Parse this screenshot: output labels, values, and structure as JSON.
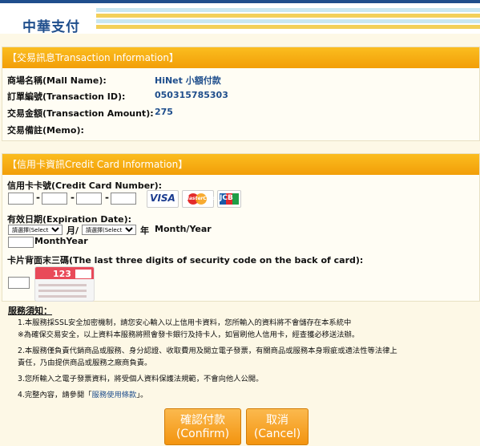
{
  "header": {
    "logo": "中華支付"
  },
  "transaction": {
    "title": "【交易訊息Transaction Information】",
    "mall_label": "商場名稱(Mall Name):",
    "mall_value": "HiNet 小額付款",
    "order_label": "訂單編號(Transaction ID):",
    "order_value": "050315785303",
    "amount_label": "交易金額(Transaction Amount):",
    "amount_value": "275",
    "memo_label": "交易備註(Memo):"
  },
  "card": {
    "title": "【信用卡資訊Credit Card Information】",
    "number_label": "信用卡卡號(Credit Card Number):",
    "logos": {
      "visa": "VISA",
      "master": "MasterCard",
      "jcb": "JCB"
    },
    "expiry_label": "有效日期(Expiration Date):",
    "month_select": "請選擇(Select)",
    "month_text": "月/",
    "year_select": "請選擇(Select)",
    "year_text": "年",
    "month_year_text": "Month/Year",
    "month_year_text2": "MonthYear",
    "cvv_label": "卡片背面末三碼(The last three digits of security code on the back of card):",
    "cvv_example": "123"
  },
  "service": {
    "title": "服務須知：",
    "items": [
      "1.本服務採SSL安全加密機制，請您安心輸入以上信用卡資料，您所輸入的資料將不會儲存在本系統中",
      "※為確保交易安全，以上資料本服務將照會發卡銀行及持卡人，如冒刷他人信用卡，經查獲必移送法辦。",
      "2.本服務僅負責代銷商品或服務、身分認證、收取費用及開立電子發票，有關商品或服務本身瑕疵或適法性等法律上",
      "責任，乃由提供商品或服務之廠商負責。",
      "3.您所輸入之電子發票資料，將受個人資料保護法規範，不會向他人公開。",
      "4.完整內容，請參閱「",
      "服務使用條款",
      "」。"
    ]
  },
  "buttons": {
    "confirm_zh": "確認付款",
    "confirm_en": "(Confirm)",
    "cancel_zh": "取消",
    "cancel_en": "(Cancel)"
  },
  "colors": {
    "accent": "#f29e08",
    "brand": "#1f4e8c"
  }
}
